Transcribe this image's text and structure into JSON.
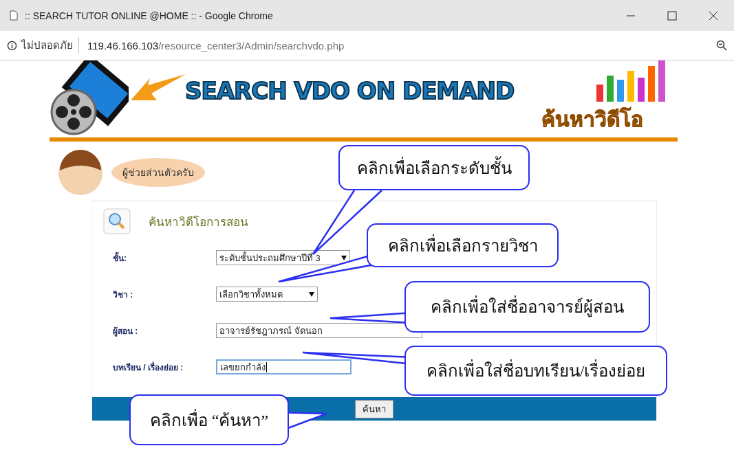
{
  "window": {
    "title": ":: SEARCH TUTOR ONLINE @HOME :: - Google Chrome"
  },
  "address_bar": {
    "security_label": "ไม่ปลอดภัย",
    "url_host": "119.46.166.103",
    "url_path": "/resource_center3/Admin/searchvdo.php"
  },
  "banner": {
    "title": "SEARCH VDO ON DEMAND",
    "subtitle": "ค้นหาวิดีโอ"
  },
  "assistant": {
    "speech": "ผู้ช่วยส่วนตัวครับ"
  },
  "form": {
    "heading": "ค้นหาวิดีโอการสอน",
    "fields": [
      {
        "kind": "select",
        "label": "ชั้น:",
        "value": "ระดับชั้นประถมศึกษาปีที่ 3",
        "focused": false
      },
      {
        "kind": "select",
        "label": "วิชา :",
        "value": "เลือกวิชาทั้งหมด",
        "focused": false
      },
      {
        "kind": "input",
        "label": "ผู้สอน :",
        "value": "อาจารย์รัชฎาภรณ์  จัดนอก",
        "focused": false
      },
      {
        "kind": "input",
        "label": "บทเรียน / เรื่องย่อย :",
        "value": "เลขยกกำลัง",
        "focused": true
      }
    ],
    "submit": "ค้นหา"
  },
  "callouts": [
    {
      "text": "คลิกเพื่อเลือกระดับชั้น"
    },
    {
      "text": "คลิกเพื่อเลือกรายวิชา"
    },
    {
      "text": "คลิกเพื่อใส่ชื่ออาจารย์ผู้สอน"
    },
    {
      "text": "คลิกเพื่อใส่ชื่อบทเรียน/เรื่องย่อย"
    },
    {
      "text": "คลิกเพื่อ “ค้นหา”"
    }
  ]
}
